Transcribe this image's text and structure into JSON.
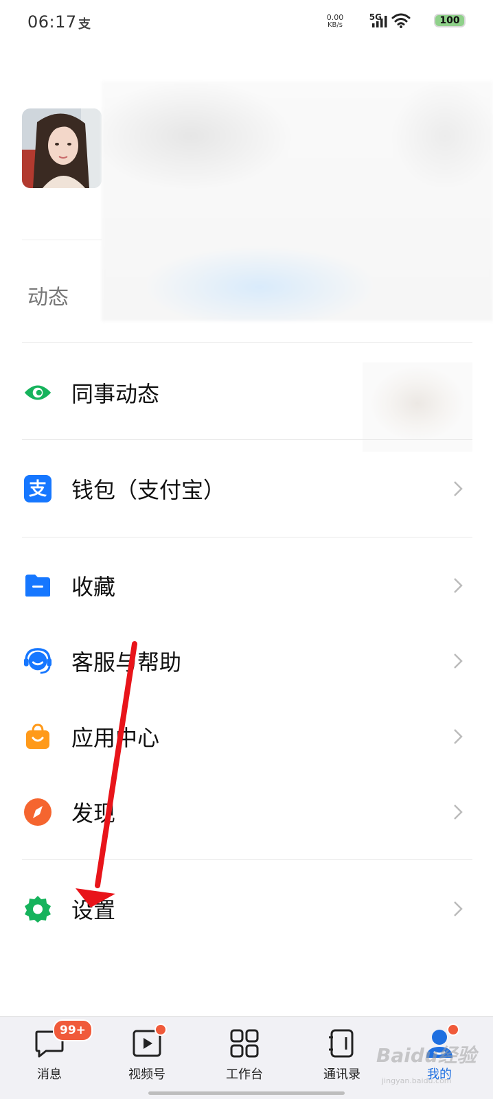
{
  "status_bar": {
    "time": "06:17",
    "app_glyph": "支",
    "net_speed_value": "0.00",
    "net_speed_unit": "KB/s",
    "network": "5G",
    "battery": "100"
  },
  "profile": {
    "dynamic_label": "动态"
  },
  "menu": {
    "colleague": "同事动态",
    "wallet": "钱包（支付宝）",
    "favorites": "收藏",
    "help": "客服与帮助",
    "app_center": "应用中心",
    "discover": "发现",
    "settings": "设置"
  },
  "bottom_nav": {
    "messages": "消息",
    "messages_badge": "99+",
    "channels": "视频号",
    "workbench": "工作台",
    "contacts": "通讯录",
    "me": "我的"
  },
  "watermark": {
    "main": "Baidu经验",
    "sub": "jingyan.baidu.com"
  },
  "colors": {
    "accent": "#1e6fe0",
    "badge": "#f05a3a",
    "annotation_arrow": "#e8141a"
  }
}
